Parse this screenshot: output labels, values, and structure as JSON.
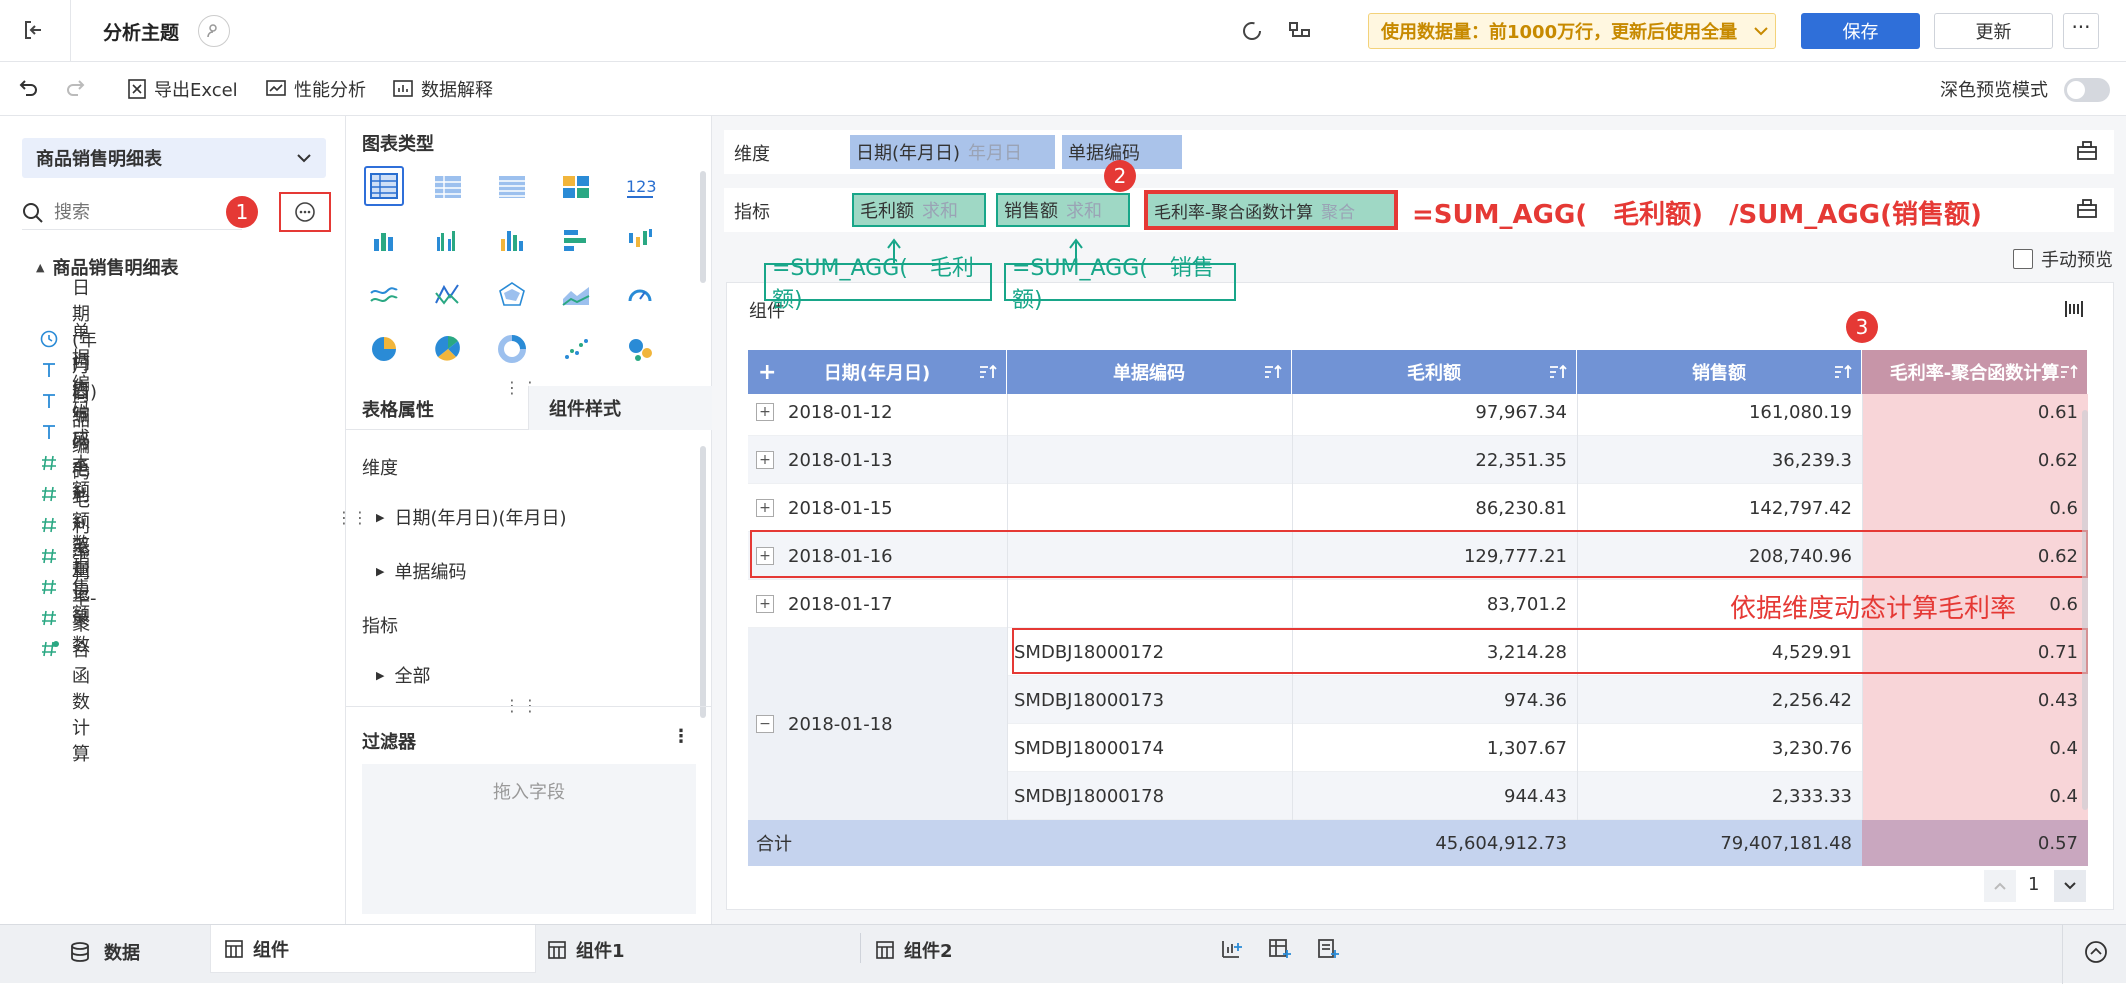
{
  "header": {
    "title": "分析主题",
    "data_notice": "使用数据量：前1000万行，更新后使用全量",
    "save_label": "保存",
    "update_label": "更新"
  },
  "toolbar": {
    "export_label": "导出Excel",
    "perf_label": "性能分析",
    "explain_label": "数据解释",
    "dark_preview_label": "深色预览模式"
  },
  "left": {
    "dataset": "商品销售明细表",
    "search_placeholder": "搜索",
    "tree_root": "商品销售明细表",
    "fields": [
      {
        "label": "日期(年月日)",
        "icon": "clock-icon"
      },
      {
        "label": "单据编码",
        "icon": "text-icon"
      },
      {
        "label": "门店编码",
        "icon": "text-icon"
      },
      {
        "label": "商品编码",
        "icon": "text-icon"
      },
      {
        "label": "成本额",
        "icon": "number-icon"
      },
      {
        "label": "毛利额",
        "icon": "number-icon"
      },
      {
        "label": "毛利率",
        "icon": "number-icon"
      },
      {
        "label": "数量",
        "icon": "number-icon"
      },
      {
        "label": "销售额",
        "icon": "number-icon"
      },
      {
        "label": "记录数",
        "icon": "number-icon"
      },
      {
        "label": "毛利率-聚合函数计算",
        "icon": "calc-icon"
      }
    ]
  },
  "middle": {
    "chart_type_title": "图表类型",
    "tab_table_props": "表格属性",
    "tab_component_style": "组件样式",
    "dim_section": "维度",
    "dim_items": [
      "日期(年月日)(年月日)",
      "单据编码"
    ],
    "metric_section": "指标",
    "metric_items": [
      "全部"
    ],
    "filter_title": "过滤器",
    "filter_placeholder": "拖入字段"
  },
  "right": {
    "dim_label": "维度",
    "dim_pills": [
      {
        "name": "日期(年月日)",
        "hint": "年月日"
      },
      {
        "name": "单据编码",
        "hint": ""
      }
    ],
    "metric_label": "指标",
    "metric_pills": [
      {
        "name": "毛利额",
        "hint": "求和"
      },
      {
        "name": "销售额",
        "hint": "求和"
      },
      {
        "name": "毛利率-聚合函数计算",
        "hint": "聚合"
      }
    ],
    "formula_main": "=SUM_AGG(　毛利额)　/SUM_AGG(销售额)",
    "formula_a": "=SUM_AGG(　毛利额)",
    "formula_b": "=SUM_AGG(　销售额)",
    "manual_preview": "手动预览",
    "component_title": "组件",
    "annotation": "依据维度动态计算毛利率",
    "badges": [
      "1",
      "2",
      "3"
    ],
    "page_number": "1"
  },
  "table": {
    "headers": [
      "日期(年月日)",
      "单据编码",
      "毛利额",
      "销售额",
      "毛利率-聚合函数计算"
    ],
    "rows": [
      {
        "date": "2018-01-12",
        "code": "",
        "profit": "97,967.34",
        "sales": "161,080.19",
        "rate": "0.61"
      },
      {
        "date": "2018-01-13",
        "code": "",
        "profit": "22,351.35",
        "sales": "36,239.3",
        "rate": "0.62"
      },
      {
        "date": "2018-01-15",
        "code": "",
        "profit": "86,230.81",
        "sales": "142,797.42",
        "rate": "0.6"
      },
      {
        "date": "2018-01-16",
        "code": "",
        "profit": "129,777.21",
        "sales": "208,740.96",
        "rate": "0.62"
      },
      {
        "date": "2018-01-17",
        "code": "",
        "profit": "83,701.2",
        "sales": "",
        "rate": "0.6"
      }
    ],
    "expanded_date": "2018-01-18",
    "sub_rows": [
      {
        "code": "SMDBJ18000172",
        "profit": "3,214.28",
        "sales": "4,529.91",
        "rate": "0.71"
      },
      {
        "code": "SMDBJ18000173",
        "profit": "974.36",
        "sales": "2,256.42",
        "rate": "0.43"
      },
      {
        "code": "SMDBJ18000174",
        "profit": "1,307.67",
        "sales": "3,230.76",
        "rate": "0.4"
      },
      {
        "code": "SMDBJ18000178",
        "profit": "944.43",
        "sales": "2,333.33",
        "rate": "0.4"
      }
    ],
    "total_label": "合计",
    "total_profit": "45,604,912.73",
    "total_sales": "79,407,181.48",
    "total_rate": "0.57"
  },
  "bottom": {
    "data_tab": "数据",
    "tabs": [
      "组件",
      "组件1",
      "组件2"
    ]
  },
  "colors": {
    "primary": "#2f6fd9",
    "header_bg": "#7193d5",
    "green": "#18a689",
    "red": "#e53935",
    "highlight_col": "#f6c7cb"
  }
}
